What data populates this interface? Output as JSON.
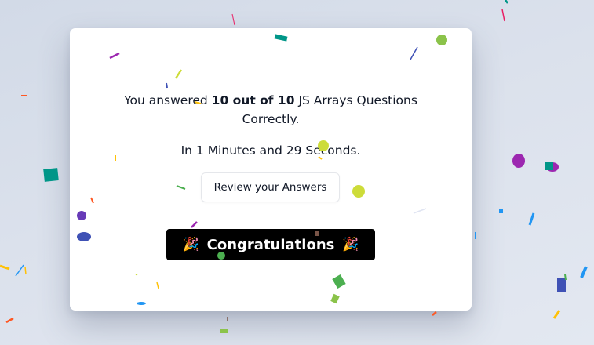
{
  "result": {
    "prefix": "You answered",
    "score": "10 out of 10",
    "suffix": "JS Arrays Questions Correctly."
  },
  "time": {
    "text": "In 1 Minutes and 29 Seconds."
  },
  "review_button": {
    "label": "Review your Answers"
  },
  "banner": {
    "label": "Congratulations",
    "icon_left": "🎉",
    "icon_right": "🎉"
  },
  "colors": {
    "background": "#d9dfea",
    "card": "#ffffff",
    "banner": "#000000",
    "confetti": [
      "#8bc34a",
      "#cddc39",
      "#673ab7",
      "#3f51b5",
      "#2196f3",
      "#009688",
      "#4caf50",
      "#ffc107",
      "#ff5722",
      "#e91e63",
      "#9c27b0",
      "#795548"
    ]
  }
}
